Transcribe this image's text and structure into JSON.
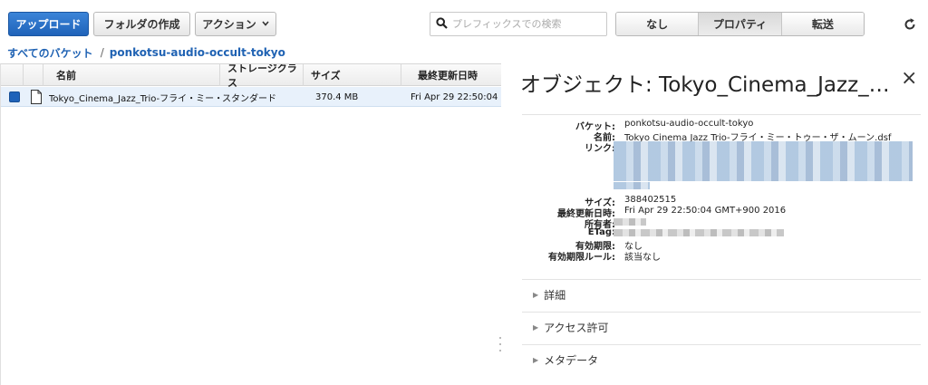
{
  "toolbar": {
    "upload_label": "アップロード",
    "create_folder_label": "フォルダの作成",
    "actions_label": "アクション",
    "search_placeholder": "プレフィックスでの検索",
    "segments": [
      "なし",
      "プロパティ",
      "転送"
    ],
    "active_segment": "プロパティ"
  },
  "breadcrumb": {
    "root": "すべてのバケット",
    "separator": "/",
    "bucket": "ponkotsu-audio-occult-tokyo"
  },
  "table": {
    "columns": [
      "名前",
      "ストレージクラス",
      "サイズ",
      "最終更新日時"
    ],
    "rows": [
      {
        "name": "Tokyo_Cinema_Jazz_Trio-フライ・ミー・…",
        "storage_class": "スタンダード",
        "size": "370.4 MB",
        "modified": "Fri Apr 29 22:50:04 G"
      }
    ]
  },
  "panel": {
    "title": "オブジェクト: Tokyo_Cinema_Jazz_T…",
    "close_label": "×",
    "properties": {
      "bucket_label": "バケット:",
      "bucket_value": "ponkotsu-audio-occult-tokyo",
      "name_label": "名前:",
      "name_value": "Tokyo Cinema Jazz Trio-フライ・ミー・トゥー・ザ・ムーン.dsf",
      "link_label": "リンク:",
      "size_label": "サイズ:",
      "size_value": "388402515",
      "modified_label": "最終更新日時:",
      "modified_value": "Fri Apr 29 22:50:04 GMT+900 2016",
      "owner_label": "所有者:",
      "etag_label": "ETag:",
      "expiry_label": "有効期限:",
      "expiry_value": "なし",
      "expiry_rule_label": "有効期限ルール:",
      "expiry_rule_value": "該当なし"
    },
    "sections": [
      "詳細",
      "アクセス許可",
      "メタデータ"
    ]
  },
  "colors": {
    "primary": "#1f63b9",
    "selected_row": "#e8f1fb",
    "link": "#1f62b3"
  },
  "icons": {
    "search": "search-icon",
    "refresh": "refresh-icon",
    "file": "file-icon",
    "chevron": "chevron-down-icon"
  }
}
